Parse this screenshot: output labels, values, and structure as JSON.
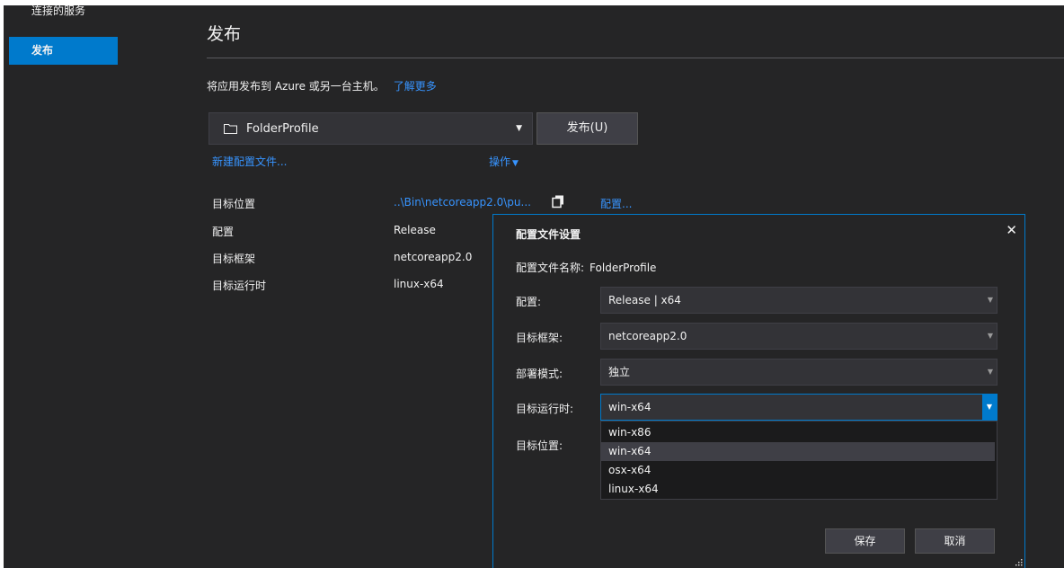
{
  "sidebar": {
    "items": [
      {
        "label": "连接的服务"
      },
      {
        "label": "发布"
      }
    ]
  },
  "page": {
    "title": "发布",
    "description": "将应用发布到 Azure 或另一台主机。",
    "learn_more": "了解更多"
  },
  "profile": {
    "selected": "FolderProfile",
    "publish_button": "发布(U)",
    "new_profile_link": "新建配置文件...",
    "actions_link": "操作",
    "actions_icon": "triangle-down"
  },
  "properties": {
    "target_location_label": "目标位置",
    "target_location_value": "..\\Bin\\netcoreapp2.0\\pu...",
    "configure_link": "配置...",
    "configuration_label": "配置",
    "configuration_value": "Release",
    "framework_label": "目标框架",
    "framework_value": "netcoreapp2.0",
    "runtime_label": "目标运行时",
    "runtime_value": "linux-x64"
  },
  "dialog": {
    "title": "配置文件设置",
    "close": "✕",
    "profile_name_label": "配置文件名称:",
    "profile_name_value": "FolderProfile",
    "configuration_label": "配置:",
    "configuration_value": "Release | x64",
    "framework_label": "目标框架:",
    "framework_value": "netcoreapp2.0",
    "deploy_mode_label": "部署模式:",
    "deploy_mode_value": "独立",
    "runtime_label": "目标运行时:",
    "runtime_value": "win-x64",
    "target_location_label": "目标位置:",
    "runtime_options": [
      "win-x86",
      "win-x64",
      "osx-x64",
      "linux-x64"
    ],
    "runtime_selected_index": 1,
    "save_button": "保存",
    "cancel_button": "取消"
  },
  "colors": {
    "background": "#252526",
    "accent": "#007acc",
    "link": "#3794ff",
    "control": "#333337"
  }
}
